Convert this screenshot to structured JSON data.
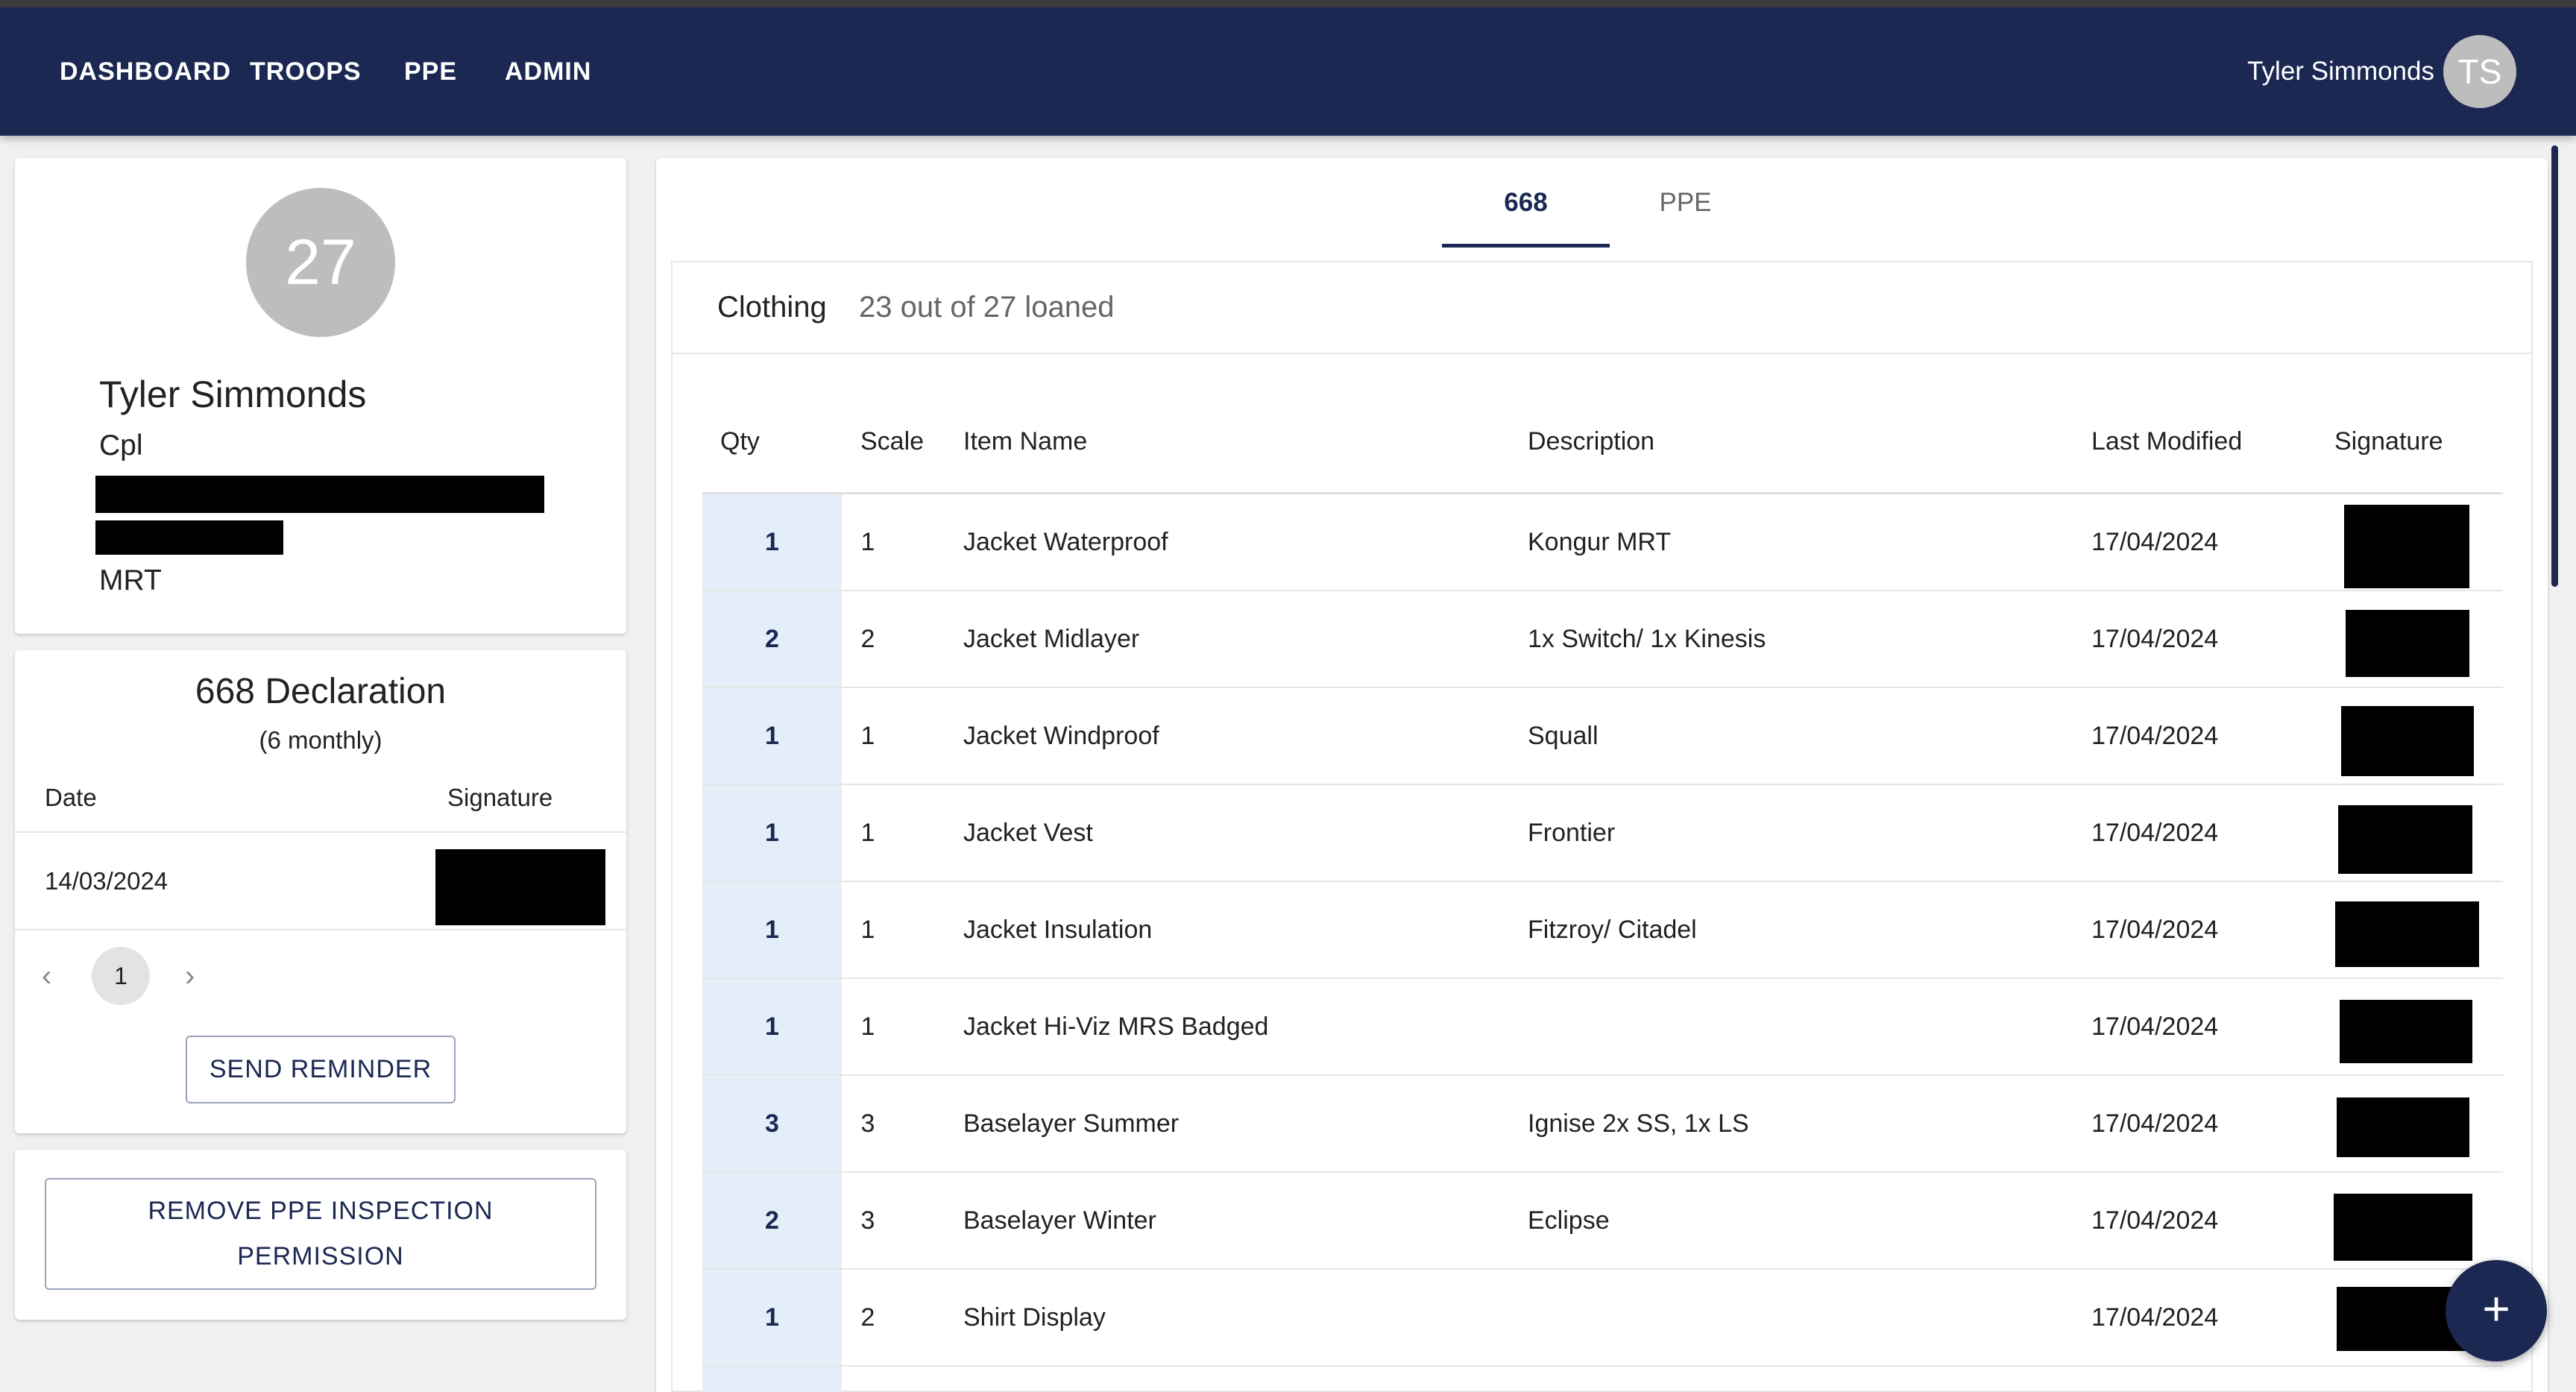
{
  "nav": {
    "items": [
      "DASHBOARD",
      "TROOPS",
      "PPE",
      "ADMIN"
    ],
    "user_name": "Tyler Simmonds",
    "user_initials": "TS"
  },
  "profile": {
    "avatar_number": "27",
    "name": "Tyler Simmonds",
    "rank": "Cpl",
    "team": "MRT"
  },
  "declaration": {
    "title": "668 Declaration",
    "subtitle": "(6 monthly)",
    "col_date": "Date",
    "col_signature": "Signature",
    "rows": [
      {
        "date": "14/03/2024"
      }
    ],
    "current_page": "1",
    "reminder_button": "SEND REMINDER"
  },
  "permission": {
    "button_line1": "REMOVE PPE INSPECTION",
    "button_line2": "PERMISSION"
  },
  "tabs": [
    {
      "label": "668",
      "active": true
    },
    {
      "label": "PPE",
      "active": false
    }
  ],
  "clothing": {
    "title": "Clothing",
    "loan_summary": "23 out of 27 loaned",
    "columns": [
      "Qty",
      "Scale",
      "Item Name",
      "Description",
      "Last Modified",
      "Signature"
    ],
    "rows": [
      {
        "qty": "1",
        "scale": "1",
        "item": "Jacket Waterproof",
        "description": "Kongur MRT",
        "date": "17/04/2024"
      },
      {
        "qty": "2",
        "scale": "2",
        "item": "Jacket Midlayer",
        "description": "1x Switch/ 1x Kinesis",
        "date": "17/04/2024"
      },
      {
        "qty": "1",
        "scale": "1",
        "item": "Jacket Windproof",
        "description": "Squall",
        "date": "17/04/2024"
      },
      {
        "qty": "1",
        "scale": "1",
        "item": "Jacket Vest",
        "description": "Frontier",
        "date": "17/04/2024"
      },
      {
        "qty": "1",
        "scale": "1",
        "item": "Jacket Insulation",
        "description": "Fitzroy/ Citadel",
        "date": "17/04/2024"
      },
      {
        "qty": "1",
        "scale": "1",
        "item": "Jacket Hi-Viz MRS Badged",
        "description": "",
        "date": "17/04/2024"
      },
      {
        "qty": "3",
        "scale": "3",
        "item": "Baselayer Summer",
        "description": "Ignise 2x SS, 1x LS",
        "date": "17/04/2024"
      },
      {
        "qty": "2",
        "scale": "3",
        "item": "Baselayer Winter",
        "description": "Eclipse",
        "date": "17/04/2024"
      },
      {
        "qty": "1",
        "scale": "2",
        "item": "Shirt Display",
        "description": "",
        "date": "17/04/2024"
      }
    ]
  },
  "fab": {
    "icon": "plus-icon",
    "label": "+"
  },
  "colors": {
    "primary": "#1b2852",
    "qty_column_bg": "#e3eef9",
    "avatar_gray": "#bdbdbd"
  }
}
